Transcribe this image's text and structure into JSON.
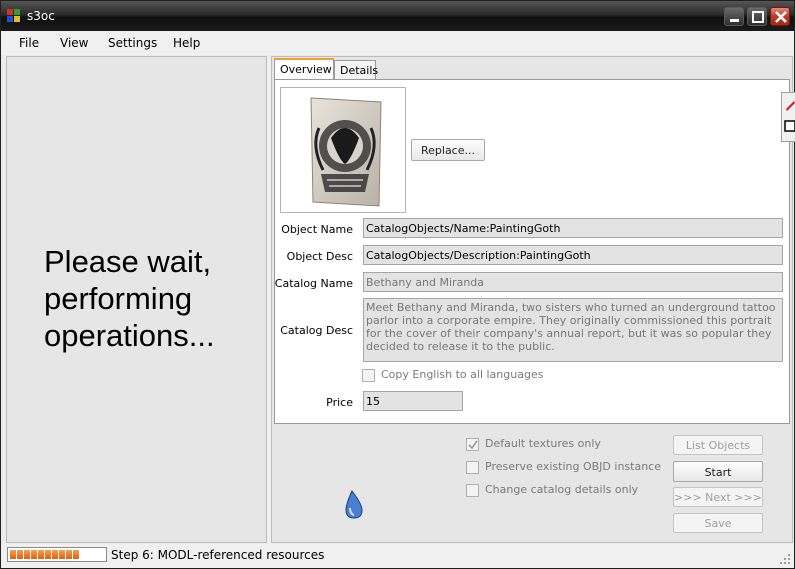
{
  "window": {
    "title": "s3oc"
  },
  "menu": {
    "items": [
      {
        "label": "File"
      },
      {
        "label": "View"
      },
      {
        "label": "Settings"
      },
      {
        "label": "Help"
      }
    ]
  },
  "left_pane": {
    "message_line1": "Please wait,",
    "message_line2": "performing",
    "message_line3": "operations..."
  },
  "tabs": [
    {
      "label": "Overview",
      "active": true
    },
    {
      "label": "Details",
      "active": false
    }
  ],
  "overview": {
    "replace_button": "Replace...",
    "object_name_label": "Object Name",
    "object_name_value": "CatalogObjects/Name:PaintingGoth",
    "object_desc_label": "Object Desc",
    "object_desc_value": "CatalogObjects/Description:PaintingGoth",
    "catalog_name_label": "Catalog Name",
    "catalog_name_value": "Bethany and Miranda",
    "catalog_desc_label": "Catalog Desc",
    "catalog_desc_value": "Meet Bethany and Miranda, two sisters who turned an underground tattoo parlor into a corporate empire. They originally commissioned this portrait for the cover of their company's annual report, but it was so popular they decided to release it to the public.",
    "copy_english_label": "Copy English to all languages",
    "copy_english_checked": false,
    "price_label": "Price",
    "price_value": "15"
  },
  "options": {
    "default_textures_label": "Default textures only",
    "default_textures_checked": true,
    "preserve_objd_label": "Preserve existing OBJD instance",
    "preserve_objd_checked": false,
    "change_catalog_label": "Change catalog details only",
    "change_catalog_checked": false
  },
  "actions": {
    "list_objects": "List Objects",
    "start": "Start",
    "next": ">>> Next >>>",
    "save": "Save"
  },
  "status": {
    "text": "Step 6: MODL-referenced resources",
    "progress": 0.75
  },
  "colors": {
    "progress_orange": "#e86a14",
    "close_red": "#c0392b",
    "tab_accent": "#f0a030"
  }
}
